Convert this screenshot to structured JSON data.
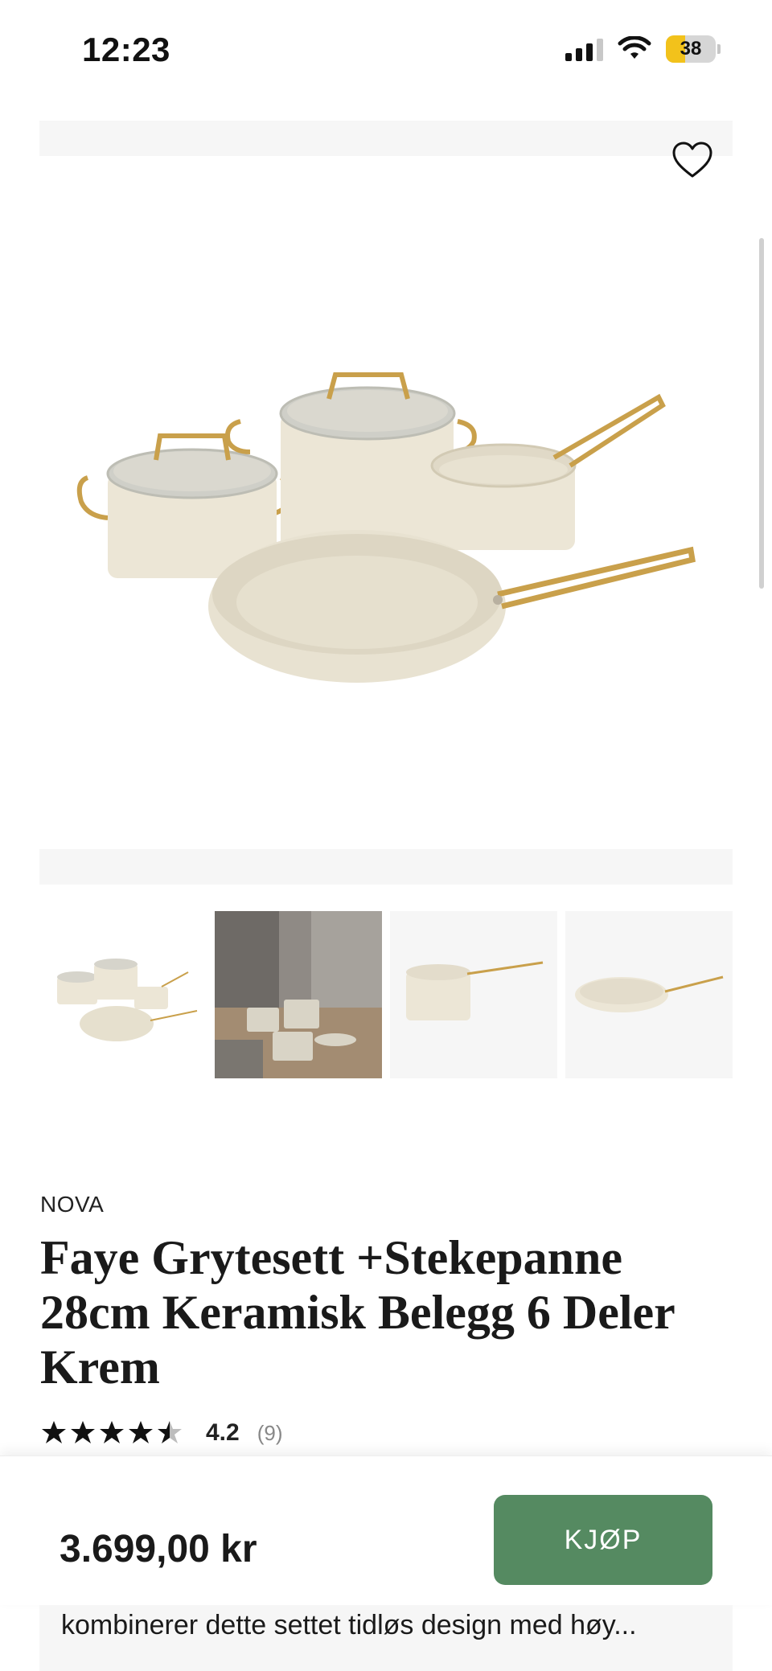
{
  "status_bar": {
    "time": "12:23",
    "battery_level": "38",
    "battery_fill_fraction": 0.38,
    "signal_bars_active": 3,
    "signal_bars_total": 4,
    "wifi_icon": "wifi-icon"
  },
  "gallery": {
    "favorite_icon": "heart-outline-icon",
    "thumbnails": [
      {
        "name": "thumb-cookware-set"
      },
      {
        "name": "thumb-kitchen-scene"
      },
      {
        "name": "thumb-saucepan"
      },
      {
        "name": "thumb-frying-pan"
      }
    ]
  },
  "product": {
    "brand": "NOVA",
    "title": "Faye Grytesett +Stekepanne 28cm Keramisk Belegg 6 Deler Krem",
    "rating_value": "4.2",
    "rating_count": "(9)",
    "rating_stars": 4.5
  },
  "buy_bar": {
    "price": "3.699,00 kr",
    "buy_label": "KJØP"
  },
  "description": {
    "snippet": "kombinerer dette settet tidløs design med høy..."
  },
  "colors": {
    "buy_button": "#558a61",
    "cream": "#ece6d6",
    "gold": "#c9a04b"
  }
}
